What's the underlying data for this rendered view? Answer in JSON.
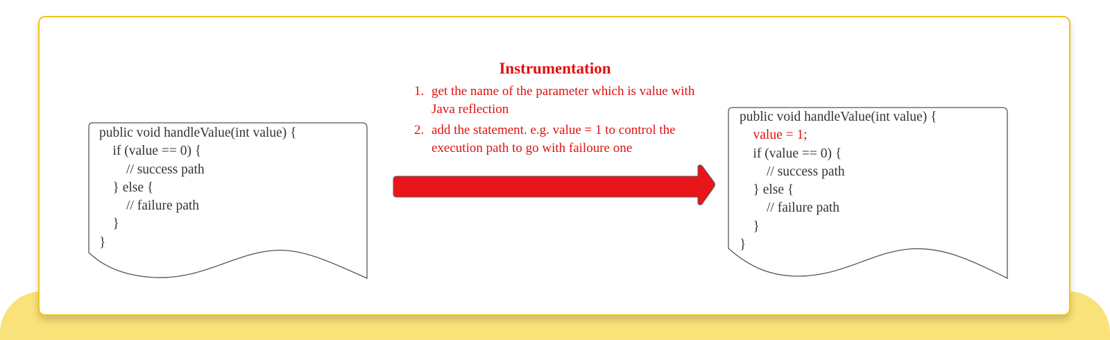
{
  "instrumentation": {
    "title": "Instrumentation",
    "steps": [
      {
        "number": "1.",
        "text": "get the name of the parameter which is value with Java reflection"
      },
      {
        "number": "2.",
        "text": "add the statement. e.g. value = 1 to control the execution path to go with failoure one"
      }
    ]
  },
  "original_code": {
    "lines": [
      "public void handleValue(int value) {",
      "    if (value == 0) {",
      "        // success path",
      "    } else {",
      "        // failure path",
      "    }",
      "}"
    ]
  },
  "instrumented_code": {
    "lines": [
      "public void handleValue(int value) {",
      "    value = 1;",
      "    if (value == 0) {",
      "        // success path",
      "    } else {",
      "        // failure path",
      "    }",
      "}"
    ],
    "highlighted_line_index": 1
  },
  "colors": {
    "accent_red": "#e01010",
    "arrow_red": "#e8161a",
    "card_border": "#f2c318",
    "base_yellow": "#f9e27a",
    "code_text": "#333333"
  }
}
